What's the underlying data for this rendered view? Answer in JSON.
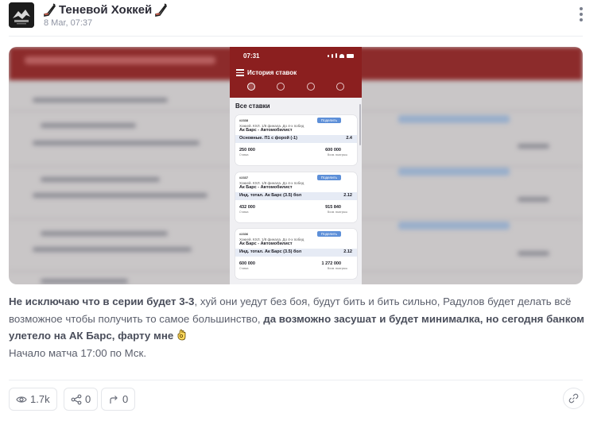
{
  "header": {
    "channel_name": "Теневой Хоккей",
    "date": "8 Mar, 07:37",
    "avatar_icon": "hockey-logo-icon",
    "title_icon": "hockey-stick-icon",
    "more_icon": "vertical-dots-icon"
  },
  "media": {
    "phone": {
      "time": "07:31",
      "title": "История ставок",
      "section": "Все ставки",
      "bets": [
        {
          "id": "#2338",
          "share": "Поделить",
          "league": "Хоккей. КХЛ. 1/8 финала. До 4-х побед",
          "teams": "Ак Барс - Автомобилист",
          "market": "Основные. П1 с форой (-1)",
          "odds": "2.4",
          "stake": "250 000",
          "stake_label": "Ставка",
          "win": "600 000",
          "win_label": "Возм. выигрыш"
        },
        {
          "id": "#2337",
          "share": "Поделить",
          "league": "Хоккей. КХЛ. 1/8 финала. До 4-х побед",
          "teams": "Ак Барс - Автомобилист",
          "market": "Инд. тотал. Ак Барс (3.5) бол",
          "odds": "2.12",
          "stake": "432 000",
          "stake_label": "Ставка",
          "win": "915 840",
          "win_label": "Возм. выигрыш"
        },
        {
          "id": "#2336",
          "share": "Поделить",
          "league": "Хоккей. КХЛ. 1/8 финала. До 4-х побед",
          "teams": "Ак Барс - Автомобилист",
          "market": "Инд. тотал. Ак Барс (3.5) бол",
          "odds": "2.12",
          "stake": "600 000",
          "stake_label": "Ставка",
          "win": "1 272 000",
          "win_label": "Возм. выигрыш"
        }
      ]
    }
  },
  "text": {
    "p1_bold": "Не исключаю что в серии будет 3-3",
    "p1_regular": ", хуй они уедут без боя, будут бить и бить сильно, Радулов будет делать всё возможное чтобы получить то самое большинство, ",
    "p1_bold2": "да возможно засушат и будет минималка, но сегодня банком улетело на АК Барс, фарту мне",
    "emoji": "ok-hand-emoji",
    "p2": "Начало матча 17:00 по Мск."
  },
  "footer": {
    "views": "1.7k",
    "shares": "0",
    "reposts": "0",
    "views_icon": "eye-icon",
    "shares_icon": "share-icon",
    "reposts_icon": "forward-icon",
    "link_icon": "link-icon"
  }
}
